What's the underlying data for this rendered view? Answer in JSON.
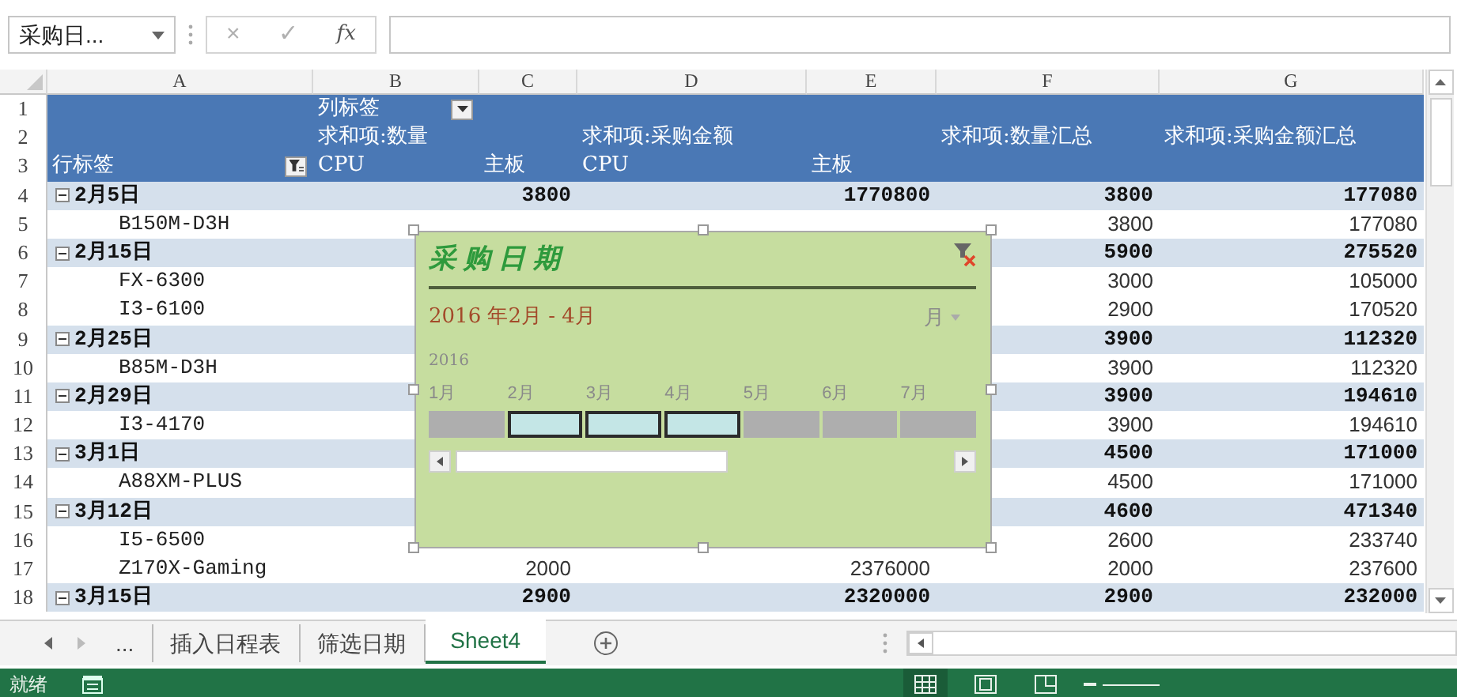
{
  "formula_bar": {
    "name_box": "采购日...",
    "cancel": "×",
    "enter": "✓",
    "function": "fx"
  },
  "column_headers": [
    "A",
    "B",
    "C",
    "D",
    "E",
    "F",
    "G"
  ],
  "row_numbers": [
    "1",
    "2",
    "3",
    "4",
    "5",
    "6",
    "7",
    "8",
    "9",
    "10",
    "11",
    "12",
    "13",
    "14",
    "15",
    "16",
    "17",
    "18"
  ],
  "pivot_header": {
    "column_labels": "列标签",
    "row_labels": "行标签",
    "measure_1": "求和项:数量",
    "measure_2": "求和项:采购金额",
    "total_1": "求和项:数量汇总",
    "total_2": "求和项:采购金额汇总",
    "sub_headers": [
      "CPU",
      "主板",
      "CPU",
      "主板"
    ]
  },
  "rows": [
    {
      "kind": "group",
      "label": "2月5日",
      "expanded": true,
      "values": {
        "C": "3800",
        "E": "1770800",
        "F": "3800",
        "G": "177080"
      }
    },
    {
      "kind": "item",
      "label": "B150M-D3H",
      "values": {
        "F": "3800",
        "G": "177080"
      }
    },
    {
      "kind": "group",
      "label": "2月15日",
      "expanded": true,
      "values": {
        "F": "5900",
        "G": "275520"
      }
    },
    {
      "kind": "item",
      "label": "FX-6300",
      "values": {
        "F": "3000",
        "G": "105000"
      }
    },
    {
      "kind": "item",
      "label": "I3-6100",
      "values": {
        "F": "2900",
        "G": "170520"
      }
    },
    {
      "kind": "group",
      "label": "2月25日",
      "expanded": true,
      "values": {
        "F": "3900",
        "G": "112320"
      }
    },
    {
      "kind": "item",
      "label": "B85M-D3H",
      "values": {
        "F": "3900",
        "G": "112320"
      }
    },
    {
      "kind": "group",
      "label": "2月29日",
      "expanded": true,
      "values": {
        "F": "3900",
        "G": "194610"
      }
    },
    {
      "kind": "item",
      "label": "I3-4170",
      "values": {
        "F": "3900",
        "G": "194610"
      }
    },
    {
      "kind": "group",
      "label": "3月1日",
      "expanded": true,
      "values": {
        "F": "4500",
        "G": "171000"
      }
    },
    {
      "kind": "item",
      "label": "A88XM-PLUS",
      "values": {
        "F": "4500",
        "G": "171000"
      }
    },
    {
      "kind": "group",
      "label": "3月12日",
      "expanded": true,
      "values": {
        "F": "4600",
        "G": "471340"
      }
    },
    {
      "kind": "item",
      "label": "I5-6500",
      "values": {
        "F": "2600",
        "G": "233740"
      }
    },
    {
      "kind": "item",
      "label": "Z170X-Gaming",
      "values": {
        "C": "2000",
        "E": "2376000",
        "F": "2000",
        "G": "237600"
      }
    },
    {
      "kind": "group",
      "label": "3月15日",
      "expanded": true,
      "values": {
        "C": "2900",
        "E": "2320000",
        "F": "2900",
        "G": "232000"
      }
    }
  ],
  "timeline": {
    "title": "采购日期",
    "range": "2016 年2月 - 4月",
    "time_level": "月",
    "year": "2016",
    "months": [
      {
        "label": "1月",
        "selected": false
      },
      {
        "label": "2月",
        "selected": true
      },
      {
        "label": "3月",
        "selected": true
      },
      {
        "label": "4月",
        "selected": true
      },
      {
        "label": "5月",
        "selected": false
      },
      {
        "label": "6月",
        "selected": false
      },
      {
        "label": "7月",
        "selected": false
      }
    ]
  },
  "sheet_tabs": {
    "overflow": "...",
    "tabs": [
      {
        "label": "插入日程表",
        "selected": false
      },
      {
        "label": "筛选日期",
        "selected": false
      },
      {
        "label": "Sheet4",
        "selected": true
      }
    ]
  },
  "status_bar": {
    "text": "就绪",
    "views": [
      {
        "kind": "normal",
        "selected": true
      },
      {
        "kind": "page_layout",
        "selected": false
      },
      {
        "kind": "page_break",
        "selected": false
      }
    ]
  }
}
